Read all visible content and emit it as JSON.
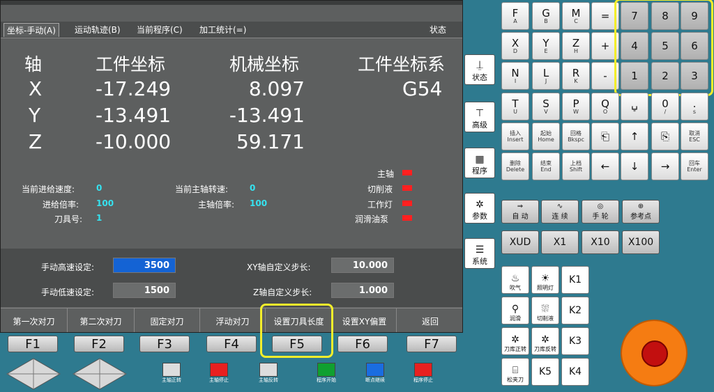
{
  "tabs": [
    {
      "label": "坐标-手动(A)"
    },
    {
      "label": "运动轨迹(B)"
    },
    {
      "label": "当前程序(C)"
    },
    {
      "label": "加工统计(=)"
    }
  ],
  "status_label": "状态",
  "coords": {
    "headers": {
      "axis": "轴",
      "work": "工件坐标",
      "machine": "机械坐标",
      "system": "工件坐标系"
    },
    "rows": [
      {
        "axis": "X",
        "work": "-17.249",
        "machine": "8.097"
      },
      {
        "axis": "Y",
        "work": "-13.491",
        "machine": "-13.491"
      },
      {
        "axis": "Z",
        "work": "-10.000",
        "machine": "59.171"
      }
    ],
    "system_value": "G54"
  },
  "info": {
    "feed_speed_label": "当前进给速度:",
    "feed_speed": "0",
    "feed_rate_label": "进给倍率:",
    "feed_rate": "100",
    "tool_label": "刀具号:",
    "tool": "1",
    "spindle_speed_label": "当前主轴转速:",
    "spindle_speed": "0",
    "spindle_rate_label": "主轴倍率:",
    "spindle_rate": "100"
  },
  "indicators": [
    {
      "label": "主轴",
      "color": "#ff2020"
    },
    {
      "label": "切削液",
      "color": "#ff2020"
    },
    {
      "label": "工作灯",
      "color": "#ff2020"
    },
    {
      "label": "润滑油泵",
      "color": "#ff2020"
    }
  ],
  "settings": {
    "manual_high_label": "手动高速设定:",
    "manual_high": "3500",
    "manual_low_label": "手动低速设定:",
    "manual_low": "1500",
    "xy_step_label": "XY轴自定义步长:",
    "xy_step": "10.000",
    "z_step_label": "Z轴自定义步长:",
    "z_step": "1.000"
  },
  "softkeys": [
    "第一次对刀",
    "第二次对刀",
    "固定对刀",
    "浮动对刀",
    "设置刀具长度",
    "设置XY偏置",
    "返回"
  ],
  "fkeys": [
    "F1",
    "F2",
    "F3",
    "F4",
    "F5",
    "F6",
    "F7"
  ],
  "controls": [
    "主轴正转",
    "主轴停止",
    "主轴反转",
    "程序开始",
    "断点继续",
    "程序停止"
  ],
  "side_buttons": [
    "状态",
    "高级",
    "程序",
    "参数",
    "系统"
  ],
  "keypad": {
    "r1": [
      {
        "m": "F",
        "s": "A"
      },
      {
        "m": "G",
        "s": "B"
      },
      {
        "m": "M",
        "s": "C"
      },
      {
        "m": "=",
        "s": ""
      }
    ],
    "r2": [
      {
        "m": "X",
        "s": "D"
      },
      {
        "m": "Y",
        "s": "E"
      },
      {
        "m": "Z",
        "s": "H"
      },
      {
        "m": "+",
        "s": ""
      }
    ],
    "r3": [
      {
        "m": "N",
        "s": "I"
      },
      {
        "m": "L",
        "s": "J"
      },
      {
        "m": "R",
        "s": "K"
      },
      {
        "m": "-",
        "s": ""
      }
    ],
    "r4": [
      {
        "m": "T",
        "s": "U"
      },
      {
        "m": "S",
        "s": "V"
      },
      {
        "m": "P",
        "s": "W"
      },
      {
        "m": "Q",
        "s": "O"
      },
      {
        "m": "␣",
        "s": "*"
      },
      {
        "m": "0",
        "s": "/"
      },
      {
        "m": ".",
        "s": "s"
      }
    ],
    "num": [
      "7",
      "8",
      "9",
      "4",
      "5",
      "6",
      "1",
      "2",
      "3"
    ],
    "edit": [
      {
        "m": "插入",
        "s": "Insert"
      },
      {
        "m": "起始",
        "s": "Home"
      },
      {
        "m": "回格",
        "s": "Bkspc"
      }
    ],
    "edit_right": [
      {
        "m": "取消",
        "s": "ESC"
      }
    ],
    "edit2": [
      {
        "m": "删除",
        "s": "Delete"
      },
      {
        "m": "结束",
        "s": "End"
      },
      {
        "m": "上档",
        "s": "Shift"
      }
    ],
    "edit2_right": [
      {
        "m": "回车",
        "s": "Enter"
      }
    ]
  },
  "modes": [
    "自 动",
    "连 续",
    "手 轮",
    "参考点"
  ],
  "multipliers": [
    "XUD",
    "X1",
    "X10",
    "X100"
  ],
  "lamps": [
    "吹气",
    "照明灯",
    "润滑",
    "切削液",
    "刀库正转",
    "刀库反转",
    "松夹刀"
  ],
  "k_keys": [
    "K1",
    "K2",
    "K3",
    "K5",
    "K4"
  ]
}
